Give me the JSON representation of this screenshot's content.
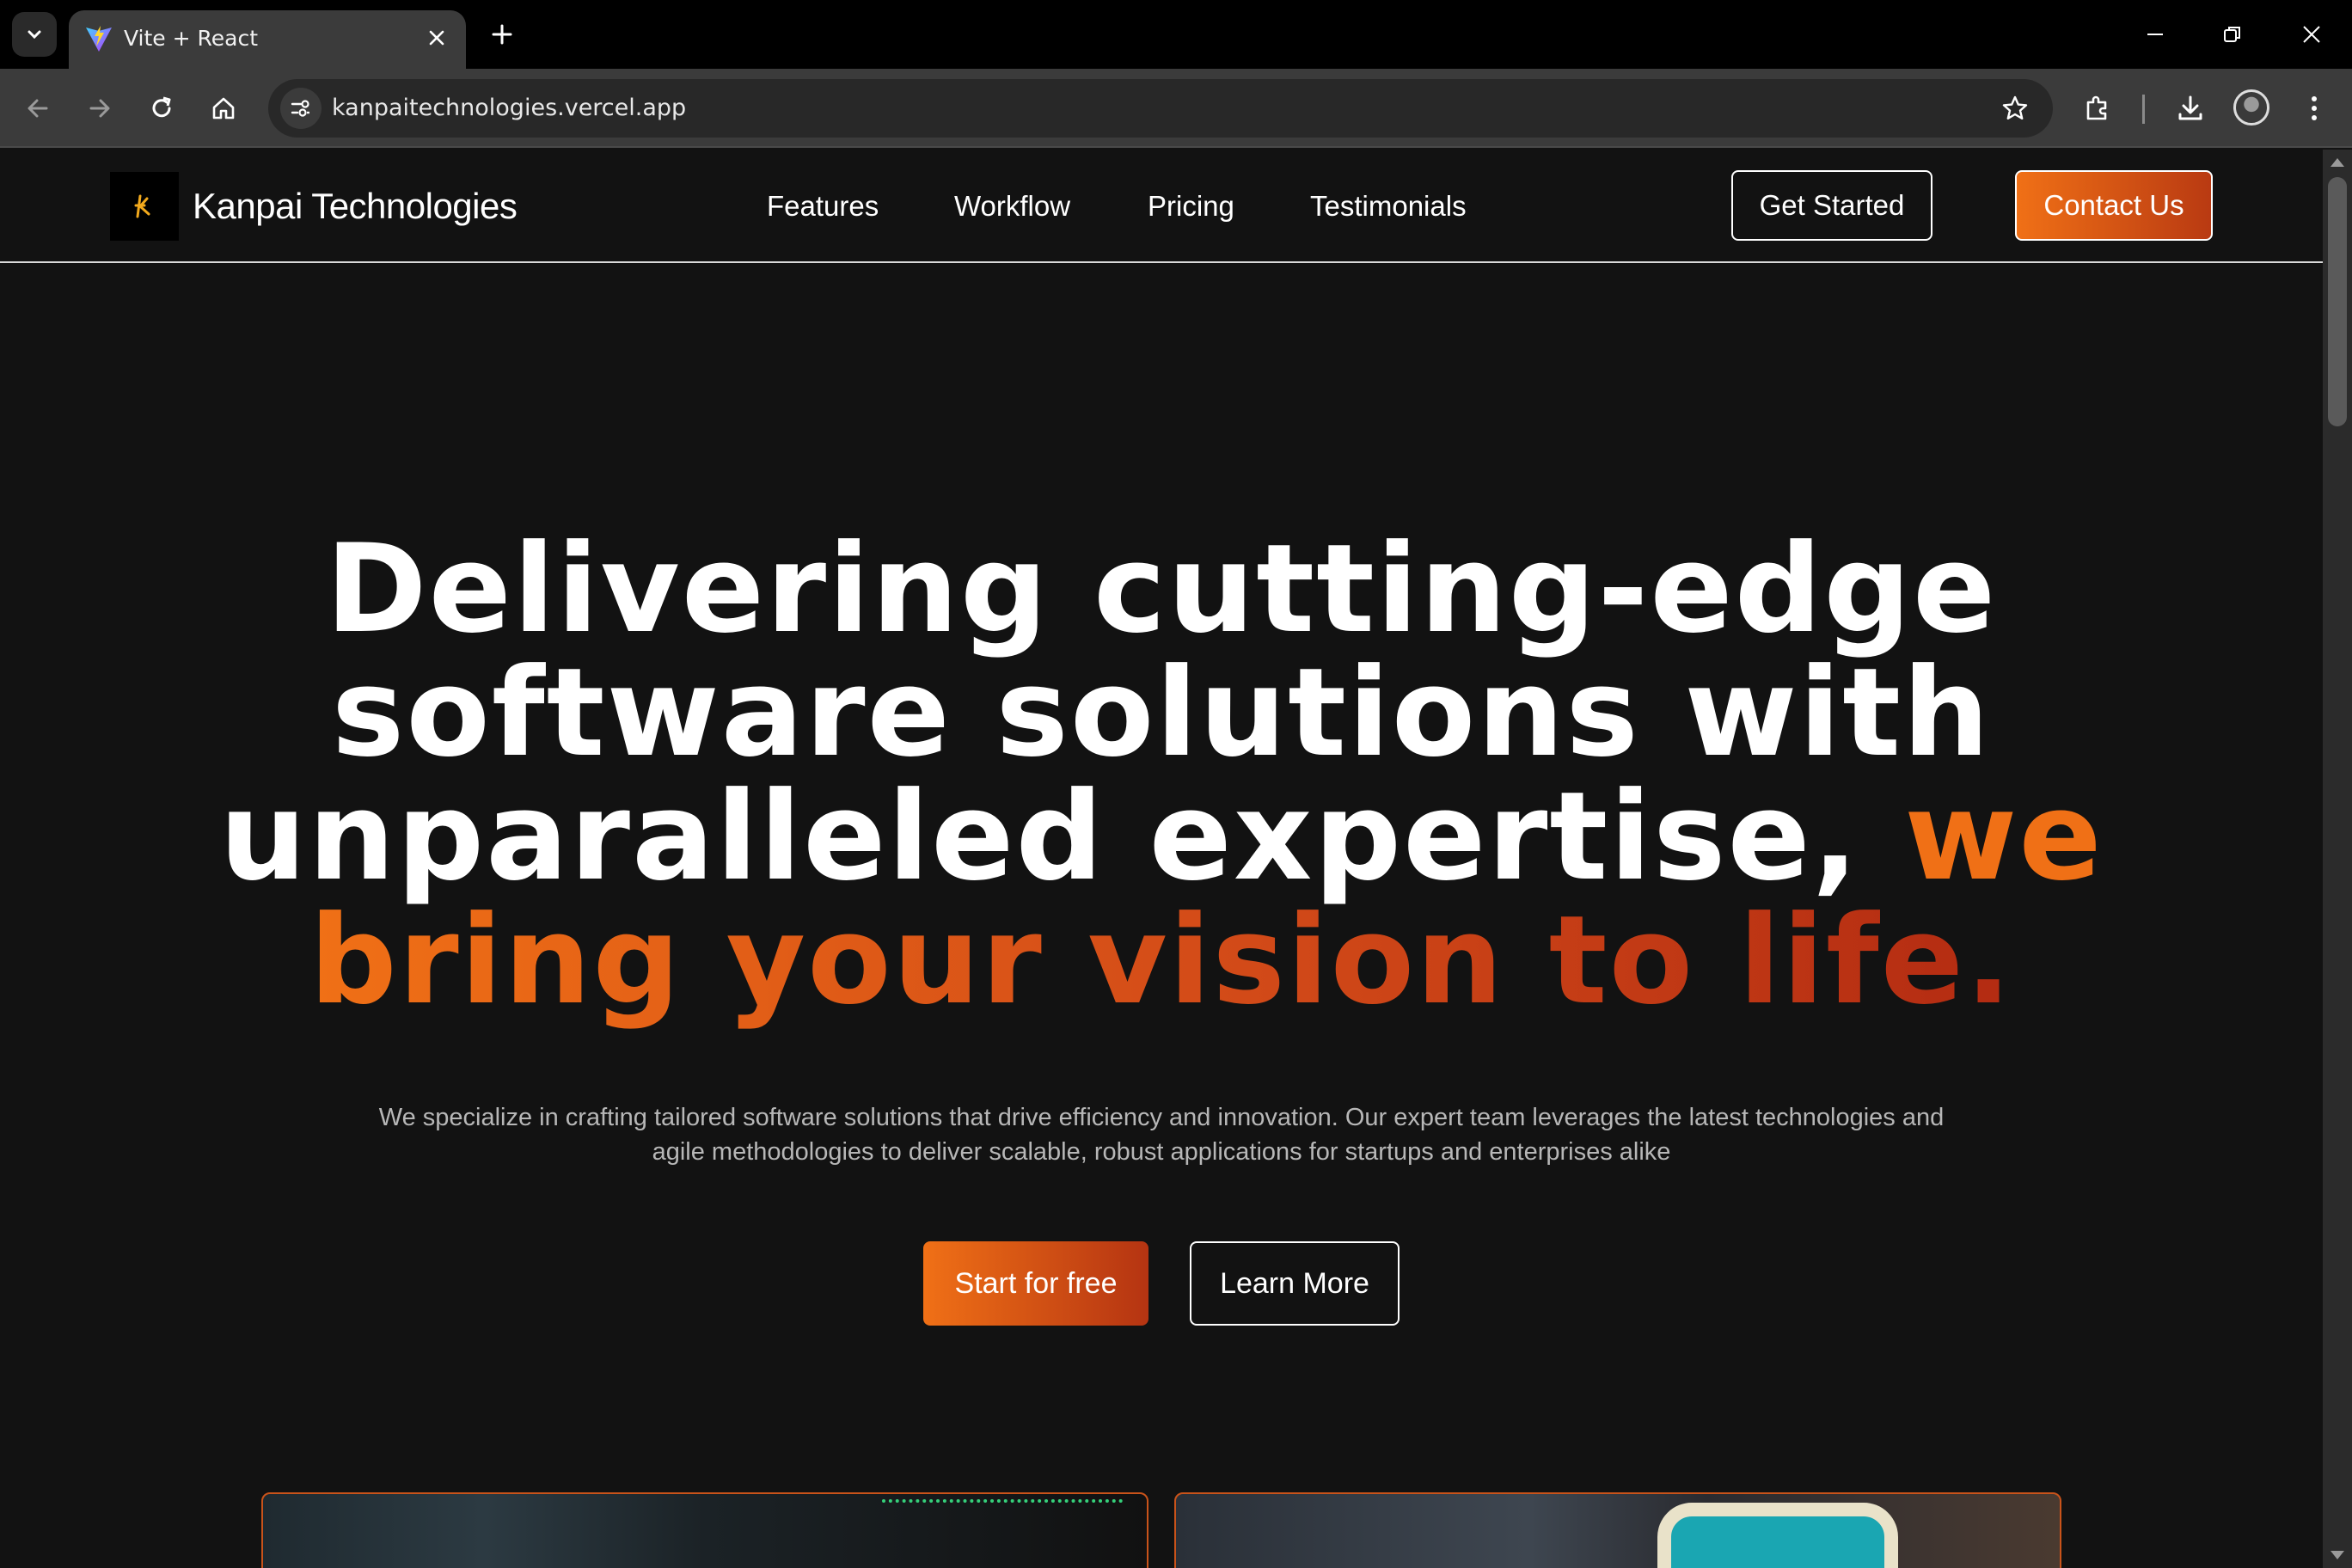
{
  "browser": {
    "tab_title": "Vite + React",
    "url": "kanpaitechnologies.vercel.app"
  },
  "nav": {
    "logo_text": "Kanpai Technologies",
    "links": [
      "Features",
      "Workflow",
      "Pricing",
      "Testimonials"
    ],
    "get_started": "Get Started",
    "contact_us": "Contact Us"
  },
  "hero": {
    "line1": "Delivering cutting-edge",
    "line2": "software solutions with",
    "line3_white": "unparalleled expertise, ",
    "line3_accent": "we",
    "line4_accent": "bring your vision to life.",
    "subtitle": "We specialize in crafting tailored software solutions that drive efficiency and innovation. Our expert team leverages the latest technologies and agile methodologies to deliver scalable, robust applications for startups and enterprises alike",
    "cta_primary": "Start for free",
    "cta_secondary": "Learn More"
  },
  "colors": {
    "accent": "#f07016",
    "accent_dark": "#b32b12",
    "background": "#121212"
  },
  "icons": [
    "tab-search-icon",
    "vite-favicon-icon",
    "close-icon",
    "plus-icon",
    "minimize-icon",
    "restore-icon",
    "back-icon",
    "forward-icon",
    "reload-icon",
    "home-icon",
    "site-info-icon",
    "star-icon",
    "extensions-icon",
    "download-icon",
    "profile-icon",
    "menu-icon"
  ]
}
